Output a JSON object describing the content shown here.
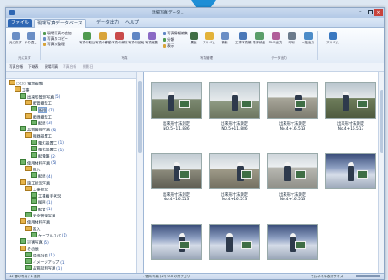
{
  "window": {
    "title": "現場写真フォト (蔵衛門)",
    "title_visible": "現場写真データ..."
  },
  "tabs": [
    {
      "label": "ファイル",
      "kind": "file"
    },
    {
      "label": "現場写真データベース",
      "kind": "active"
    },
    {
      "label": "データ出力",
      "kind": "normal"
    },
    {
      "label": "ヘルプ",
      "kind": "normal"
    }
  ],
  "ribbon": {
    "buttons": [
      {
        "label": "元に戻す",
        "color": "#6a8ec5"
      },
      {
        "label": "やり直し",
        "color": "#6a8ec5"
      },
      {
        "label": "写真の取込",
        "color": "#4f9a4f"
      },
      {
        "label": "写真の移動",
        "color": "#d8a43a"
      },
      {
        "label": "写真の削除",
        "color": "#c94b4b"
      },
      {
        "label": "写真の回転",
        "color": "#5f86c4"
      },
      {
        "label": "写真編集",
        "color": "#8a6ac5"
      },
      {
        "label": "黒板",
        "color": "#3f6e45"
      },
      {
        "label": "アルバム",
        "color": "#e3b33a"
      },
      {
        "label": "検索",
        "color": "#6a8ec5"
      },
      {
        "label": "工事写真帳",
        "color": "#4a78b8"
      },
      {
        "label": "電子納品",
        "color": "#5a9e6a"
      },
      {
        "label": "DVD出力",
        "color": "#b05e9a"
      },
      {
        "label": "印刷",
        "color": "#6b7b8c"
      },
      {
        "label": "一括出力",
        "color": "#4c8cc8"
      },
      {
        "label": "アルバム",
        "color": "#3a78c0"
      }
    ],
    "small": [
      "現場写真の追加",
      "写真のコピー",
      "写真の整理",
      "写真情報編集",
      "分類",
      "表示"
    ],
    "groups": [
      "元に戻す",
      "写真",
      "写真管理",
      "データ出力"
    ]
  },
  "toolbar2": [
    "写真台帳",
    "下端表",
    "現場写真",
    "写真台帳",
    "撮影日"
  ],
  "tree": [
    {
      "indent": 0,
      "icon": "orange",
      "label": "○○○ 電気設備",
      "count": ""
    },
    {
      "indent": 1,
      "icon": "orange",
      "label": "工事",
      "count": ""
    },
    {
      "indent": 2,
      "icon": "green",
      "label": "出来形管理写真",
      "count": "(5)"
    },
    {
      "indent": 3,
      "icon": "orange",
      "label": "配管撤去工",
      "count": ""
    },
    {
      "indent": 4,
      "icon": "green",
      "label": "配管",
      "count": "(7)",
      "selected": true
    },
    {
      "indent": 3,
      "icon": "orange",
      "label": "配線撤去工",
      "count": ""
    },
    {
      "indent": 4,
      "icon": "green",
      "label": "配線",
      "count": "(3)"
    },
    {
      "indent": 2,
      "icon": "green",
      "label": "品質管理写真",
      "count": "(5)"
    },
    {
      "indent": 3,
      "icon": "orange",
      "label": "機器設置工",
      "count": ""
    },
    {
      "indent": 4,
      "icon": "green",
      "label": "電灯設置工",
      "count": "(1)"
    },
    {
      "indent": 4,
      "icon": "green",
      "label": "電柱設置工",
      "count": "(1)"
    },
    {
      "indent": 4,
      "icon": "green",
      "label": "配電盤",
      "count": "(2)"
    },
    {
      "indent": 2,
      "icon": "green",
      "label": "使用材料写真",
      "count": "(5)"
    },
    {
      "indent": 3,
      "icon": "orange",
      "label": "搬入",
      "count": ""
    },
    {
      "indent": 4,
      "icon": "green",
      "label": "配線",
      "count": "(4)"
    },
    {
      "indent": 2,
      "icon": "orange",
      "label": "施工状況写真",
      "count": ""
    },
    {
      "indent": 3,
      "icon": "orange",
      "label": "工事状況",
      "count": ""
    },
    {
      "indent": 4,
      "icon": "green",
      "label": "工事着手状況",
      "count": ""
    },
    {
      "indent": 4,
      "icon": "green",
      "label": "掘削",
      "count": "(1)"
    },
    {
      "indent": 4,
      "icon": "green",
      "label": "配管",
      "count": "(1)"
    },
    {
      "indent": 3,
      "icon": "green",
      "label": "安全管理写真",
      "count": ""
    },
    {
      "indent": 2,
      "icon": "orange",
      "label": "使用材料写真",
      "count": ""
    },
    {
      "indent": 3,
      "icon": "orange",
      "label": "搬入",
      "count": ""
    },
    {
      "indent": 4,
      "icon": "green",
      "label": "ケーブルスパ",
      "count": "(1)"
    },
    {
      "indent": 2,
      "icon": "green",
      "label": "災害写真",
      "count": "(5)"
    },
    {
      "indent": 2,
      "icon": "orange",
      "label": "その他",
      "count": ""
    },
    {
      "indent": 3,
      "icon": "green",
      "label": "環境対策",
      "count": "(1)"
    },
    {
      "indent": 3,
      "icon": "green",
      "label": "イメージアップ",
      "count": "(1)"
    },
    {
      "indent": 3,
      "icon": "green",
      "label": "品質証明写真",
      "count": "(1)"
    }
  ],
  "photos": [
    {
      "caption": "出来形寸法測定",
      "sub": "NO.5+11.886",
      "scene": "sky"
    },
    {
      "caption": "出来形寸法測定",
      "sub": "NO.5+11.886",
      "scene": "sky2"
    },
    {
      "caption": "出来形寸法測定",
      "sub": "No.4+16.513",
      "scene": "field"
    },
    {
      "caption": "出来形寸法測定",
      "sub": "No.4+16.513",
      "scene": "field2"
    },
    {
      "caption": "出来形寸法測定",
      "sub": "No.4+16.513",
      "scene": "field3"
    },
    {
      "caption": "出来形寸法測定",
      "sub": "No.4+16.513",
      "scene": "field4"
    },
    {
      "caption": "出来形寸法測定",
      "sub": "No.4+16.513",
      "scene": "gray"
    },
    {
      "caption": "",
      "sub": "",
      "scene": "partial"
    },
    {
      "caption": "",
      "sub": "",
      "scene": "partial"
    },
    {
      "caption": "",
      "sub": "",
      "scene": "partial"
    },
    {
      "caption": "",
      "sub": "",
      "scene": "partial"
    }
  ],
  "status": {
    "left": "12 個の写真 / 1 選択",
    "middle": "1 個の写真 (22) 0.0 のカテゴリ",
    "right": "サムネイル表示サイズ"
  },
  "colors": {
    "accent": "#2e66b3",
    "cursor": "#1e8ed6"
  }
}
